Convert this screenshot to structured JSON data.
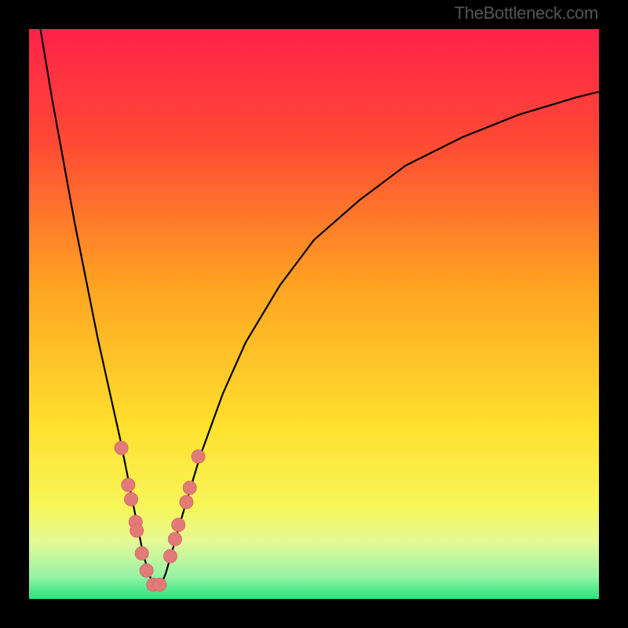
{
  "watermark": "TheBottleneck.com",
  "colors": {
    "frame": "#000000",
    "curve": "#000000",
    "marker_fill": "#e27b78",
    "marker_stroke": "#d86b68",
    "good_color": "#25e57e",
    "bad_color": "#ff2249"
  },
  "chart_data": {
    "type": "line",
    "title": "",
    "xlabel": "",
    "ylabel": "",
    "xlim": [
      0,
      100
    ],
    "ylim": [
      0,
      100
    ],
    "grid": false,
    "legend": false,
    "background_gradient": {
      "orientation": "vertical",
      "stops": [
        {
          "pos": 0.0,
          "color": "#ff2249"
        },
        {
          "pos": 0.2,
          "color": "#ff4a34"
        },
        {
          "pos": 0.45,
          "color": "#ffa321"
        },
        {
          "pos": 0.7,
          "color": "#ffe12e"
        },
        {
          "pos": 0.84,
          "color": "#f6f65a"
        },
        {
          "pos": 0.9,
          "color": "#e5f997"
        },
        {
          "pos": 0.96,
          "color": "#97f3a4"
        },
        {
          "pos": 1.0,
          "color": "#25e57e"
        }
      ]
    },
    "series": [
      {
        "name": "bottleneck-curve",
        "style": "line",
        "x": [
          2,
          4,
          6,
          8,
          10,
          12,
          14,
          16,
          18,
          19,
          20,
          21,
          22,
          23,
          24,
          25,
          27,
          30,
          34,
          38,
          44,
          50,
          58,
          66,
          76,
          86,
          96,
          100
        ],
        "y": [
          100,
          88,
          77,
          66,
          56,
          46,
          37,
          28,
          18,
          13,
          8,
          4.5,
          2,
          2,
          4.5,
          8,
          15,
          25,
          36,
          45,
          55,
          63,
          70,
          76,
          81,
          85,
          88,
          89
        ]
      },
      {
        "name": "data-markers",
        "style": "scatter",
        "x": [
          16.2,
          17.4,
          17.9,
          18.7,
          18.9,
          19.8,
          20.6,
          21.8,
          22.9,
          24.8,
          25.6,
          26.2,
          27.6,
          28.2,
          29.7
        ],
        "y": [
          26.5,
          20,
          17.5,
          13.5,
          12,
          8,
          5,
          2.5,
          2.5,
          7.5,
          10.5,
          13,
          17,
          19.5,
          25
        ]
      }
    ],
    "annotations": [
      {
        "type": "text",
        "text": "TheBottleneck.com",
        "x": 95,
        "y": 100,
        "anchor": "top-right",
        "role": "watermark"
      }
    ]
  }
}
